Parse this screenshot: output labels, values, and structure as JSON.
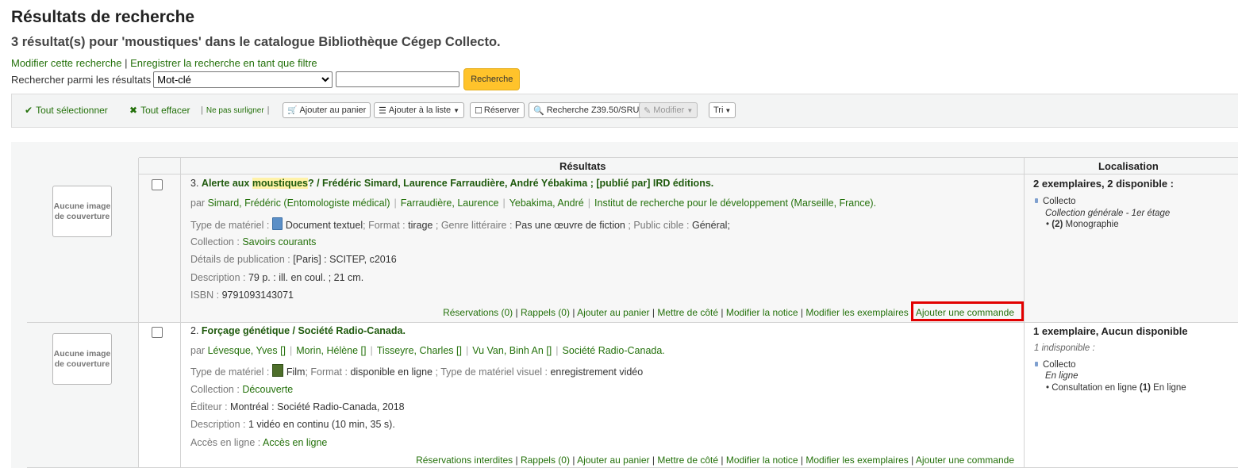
{
  "page": {
    "title": "Résultats de recherche",
    "subtitle": "3 résultat(s) pour 'moustiques' dans le catalogue Bibliothèque Cégep Collecto.",
    "modify_search": "Modifier cette recherche",
    "save_filter": "Enregistrer la recherche en tant que filtre",
    "pipe": "|"
  },
  "search": {
    "label": "Rechercher parmi les résultats",
    "select_value": "Mot-clé",
    "input_value": "",
    "button": "Recherche"
  },
  "toolbar": {
    "select_all": "Tout sélectionner",
    "clear_all": "Tout effacer",
    "no_highlight": "Ne pas surligner",
    "add_cart": "Ajouter au panier",
    "add_list": "Ajouter à la liste",
    "reserve": "Réserver",
    "z3950": "Recherche Z39.50/SRU",
    "modify": "Modifier",
    "sort": "Tri"
  },
  "table": {
    "col_results": "Résultats",
    "col_location": "Localisation",
    "no_cover": "Aucune image de couverture"
  },
  "results": [
    {
      "number": "3.",
      "title_before": "Alerte aux ",
      "title_highlight": "moustiques",
      "title_after": "? / Frédéric Simard, Laurence Farraudière, André Yébakima ; [publié par] IRD éditions.",
      "by": "par",
      "authors": [
        "Simard, Frédéric (Entomologiste médical)",
        "Farraudière, Laurence",
        "Yebakima, André",
        "Institut de recherche pour le développement (Marseille, France)."
      ],
      "material_label": "Type de matériel :",
      "material_value": "Document textuel",
      "format_label": "Format :",
      "format_value": "tirage",
      "genre_label": "Genre littéraire :",
      "genre_value": "Pas une œuvre de fiction",
      "audience_label": "Public cible :",
      "audience_value": "Général;",
      "collection_label": "Collection :",
      "collection_value": "Savoirs courants",
      "pub_label": "Détails de publication :",
      "pub_value": "[Paris] : SCITEP, c2016",
      "desc_label": "Description :",
      "desc_value": "79 p. : ill. en coul. ; 21 cm.",
      "isbn_label": "ISBN :",
      "isbn_value": "9791093143071",
      "actions": [
        "Réservations (0)",
        "Rappels (0)",
        "Ajouter au panier",
        "Mettre de côté",
        "Modifier la notice",
        "Modifier les exemplaires",
        "Ajouter une commande"
      ],
      "loc_summary": "2 exemplaires, 2 disponible :",
      "loc_library": "Collecto",
      "loc_shelf": "Collection générale - 1er étage",
      "loc_count": "(2)",
      "loc_type": "Monographie"
    },
    {
      "number": "2.",
      "title": "Forçage génétique / Société Radio-Canada.",
      "by": "par",
      "authors": [
        "Lévesque, Yves []",
        "Morin, Hélène []",
        "Tisseyre, Charles []",
        "Vu Van, Binh An []",
        "Société Radio-Canada."
      ],
      "material_label": "Type de matériel :",
      "material_value": "Film",
      "format_label": "Format :",
      "format_value": "disponible en ligne",
      "visual_label": "Type de matériel visuel :",
      "visual_value": "enregistrement vidéo",
      "collection_label": "Collection :",
      "collection_value": "Découverte",
      "publisher_label": "Éditeur :",
      "publisher_value": "Montréal : Société Radio-Canada, 2018",
      "desc_label": "Description :",
      "desc_value": "1 vidéo en continu (10 min, 35 s).",
      "online_label": "Accès en ligne :",
      "online_value": "Accès en ligne",
      "actions": [
        "Réservations interdites",
        "Rappels (0)",
        "Ajouter au panier",
        "Mettre de côté",
        "Modifier la notice",
        "Modifier les exemplaires",
        "Ajouter une commande"
      ],
      "loc_summary": "1 exemplaire, Aucun disponible",
      "loc_unavailable": "1 indisponible :",
      "loc_library": "Collecto",
      "loc_shelf": "En ligne",
      "loc_type_text": "Consultation en ligne",
      "loc_count": "(1)",
      "loc_status": "En ligne"
    }
  ]
}
